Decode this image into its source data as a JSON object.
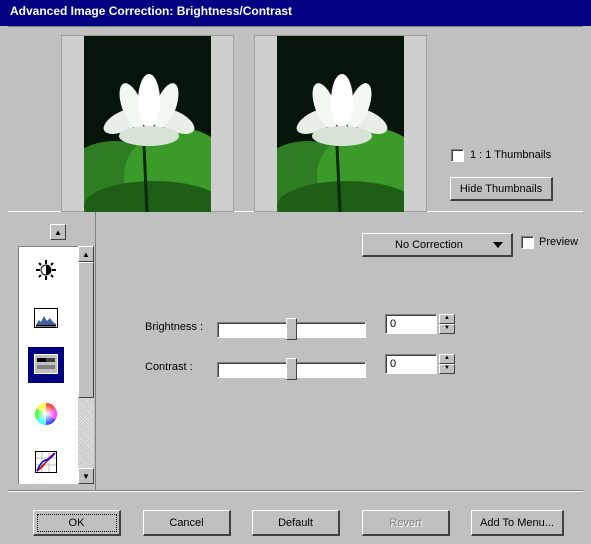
{
  "window": {
    "title": "Advanced Image Correction: Brightness/Contrast"
  },
  "thumbnails": {
    "one_to_one_label": "1 : 1 Thumbnails",
    "one_to_one_checked": false,
    "hide_button_label": "Hide Thumbnails"
  },
  "tools": {
    "items": [
      {
        "icon": "brightness-icon",
        "active": false
      },
      {
        "icon": "histogram-icon",
        "active": false
      },
      {
        "icon": "brightness-contrast-icon",
        "active": true
      },
      {
        "icon": "color-wheel-icon",
        "active": false
      },
      {
        "icon": "curves-icon",
        "active": false
      }
    ]
  },
  "correction": {
    "selected": "No Correction",
    "preview_label": "Preview",
    "preview_checked": false
  },
  "adjustments": {
    "brightness": {
      "label": "Brightness :",
      "value": "0",
      "slider_fraction": 0.5
    },
    "contrast": {
      "label": "Contrast :",
      "value": "0",
      "slider_fraction": 0.5
    }
  },
  "footer": {
    "ok_label": "OK",
    "cancel_label": "Cancel",
    "default_label": "Default",
    "revert_label": "Revert",
    "add_to_menu_label": "Add To Menu..."
  },
  "colors": {
    "titlebar": "#000080",
    "face": "#c0c0c0",
    "selected_tool": "#000080"
  }
}
